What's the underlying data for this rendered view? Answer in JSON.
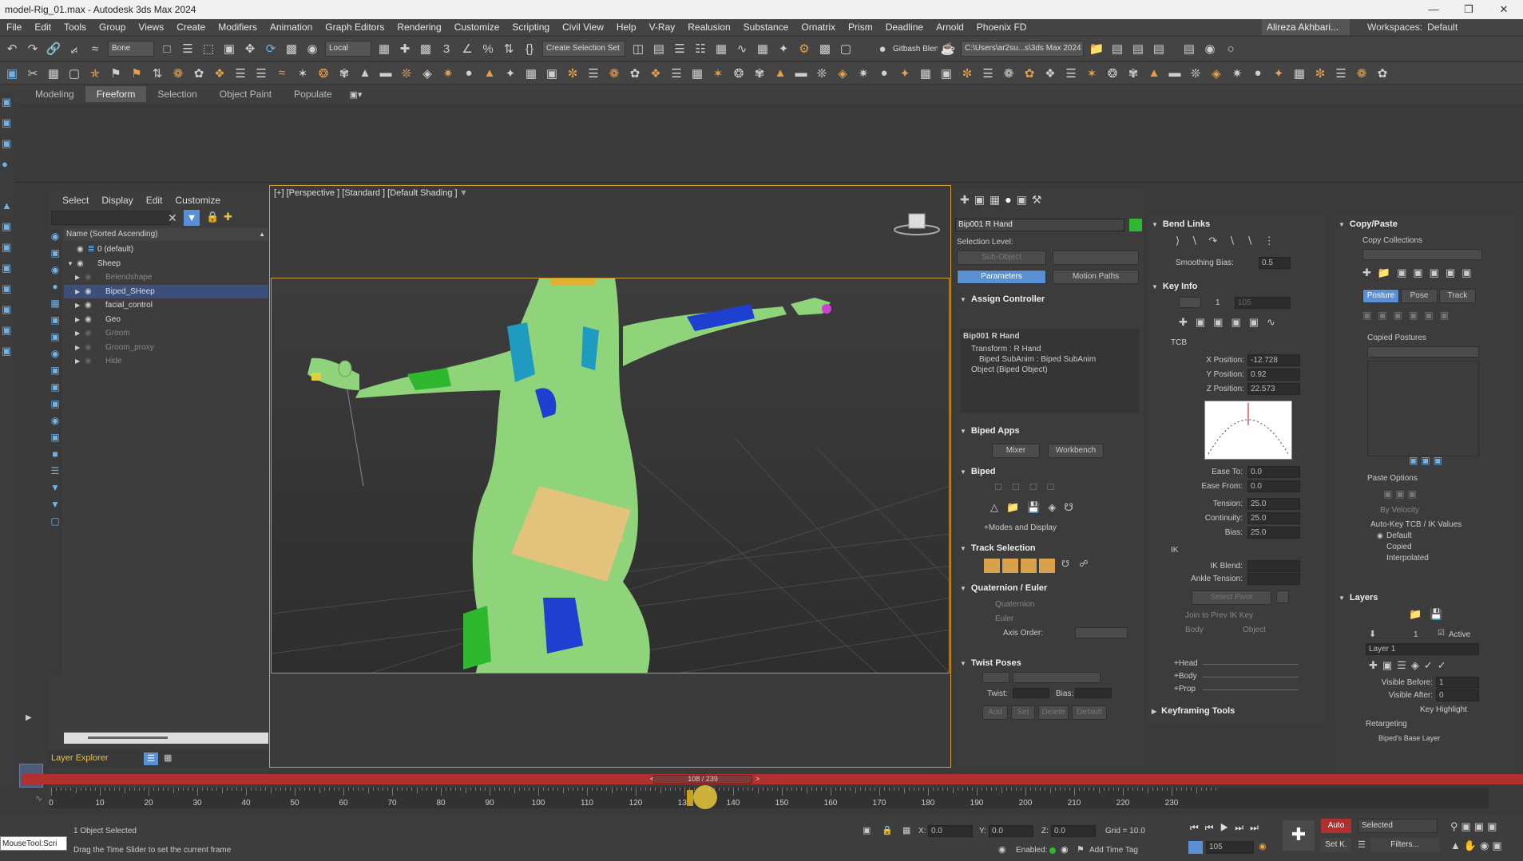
{
  "window": {
    "title": "model-Rig_01.max - Autodesk 3ds Max 2024"
  },
  "menu": {
    "items": [
      "File",
      "Edit",
      "Tools",
      "Group",
      "Views",
      "Create",
      "Modifiers",
      "Animation",
      "Graph Editors",
      "Rendering",
      "Customize",
      "Scripting",
      "Civil View",
      "Help",
      "V-Ray",
      "Realusion",
      "Substance",
      "Ornatrix",
      "Prism",
      "Deadline",
      "Arnold",
      "Phoenix FD"
    ],
    "user": "Alireza Akhbari...",
    "workspace_label": "Workspaces:",
    "workspace_value": "Default"
  },
  "toolbar": {
    "filter_value": "Bone",
    "coord_value": "Local",
    "selection_set": "Create Selection Set",
    "gitbash": "Gitbash Blender",
    "path": "C:\\Users\\ar2su...s\\3ds Max 2024"
  },
  "ribbon": {
    "tabs": [
      "Modeling",
      "Freeform",
      "Selection",
      "Object Paint",
      "Populate"
    ],
    "active": "Freeform"
  },
  "scene_explorer": {
    "menu": [
      "Select",
      "Display",
      "Edit",
      "Customize"
    ],
    "column": "Name (Sorted Ascending)",
    "rows": [
      {
        "label": "0 (default)",
        "depth": 0,
        "state": "normal"
      },
      {
        "label": "Sheep",
        "depth": 0,
        "state": "normal"
      },
      {
        "label": "Belendshape",
        "depth": 1,
        "state": "dim"
      },
      {
        "label": "Biped_SHeep",
        "depth": 1,
        "state": "sel"
      },
      {
        "label": "facial_control",
        "depth": 1,
        "state": "normal"
      },
      {
        "label": "Geo",
        "depth": 1,
        "state": "normal"
      },
      {
        "label": "Groom",
        "depth": 1,
        "state": "dim"
      },
      {
        "label": "Groom_proxy",
        "depth": 1,
        "state": "dim"
      },
      {
        "label": "Hide",
        "depth": 1,
        "state": "dim"
      }
    ],
    "footer": "Layer Explorer"
  },
  "viewport": {
    "label": "[+] [Perspective ] [Standard ] [Default Shading ]"
  },
  "command_panel": {
    "object_name": "Bip001 R Hand",
    "selection_level": "Selection Level:",
    "sub_object": "Sub-Object",
    "parameters": "Parameters",
    "motion_paths": "Motion Paths",
    "assign_controller": "Assign Controller",
    "controller_tree": [
      "Bip001 R Hand",
      "Transform : R Hand",
      "Biped SubAnim : Biped SubAnim",
      "Object (Biped Object)"
    ],
    "biped_apps": "Biped Apps",
    "mixer": "Mixer",
    "workbench": "Workbench",
    "biped": "Biped",
    "modes_display": "+Modes and Display",
    "track_selection": "Track Selection",
    "quat_euler": "Quaternion / Euler",
    "quaternion": "Quaternion",
    "euler": "Euler",
    "axis_order": "Axis Order:",
    "twist_poses": "Twist Poses",
    "twist": "Twist:",
    "bias": "Bias:",
    "add": "Add",
    "set": "Set",
    "delete": "Delete",
    "default": "Default"
  },
  "motion_panel": {
    "bend_links": "Bend Links",
    "smoothing_bias": "Smoothing Bias:",
    "smoothing_value": "0.5",
    "key_info": "Key Info",
    "key_num": "1",
    "key_num2": "105",
    "tcb": "TCB",
    "x_label": "X Position:",
    "x_value": "-12.728",
    "y_label": "Y Position:",
    "y_value": "0.92",
    "z_label": "Z Position:",
    "z_value": "22.573",
    "ease_to": "Ease To:",
    "ease_to_v": "0.0",
    "ease_from": "Ease From:",
    "ease_from_v": "0.0",
    "tension": "Tension:",
    "tension_v": "25.0",
    "continuity": "Continuity:",
    "continuity_v": "25.0",
    "bias": "Bias:",
    "bias_v": "25.0",
    "ik": "IK",
    "ik_blend": "IK Blend:",
    "ankle": "Ankle Tension:",
    "select_pivot": "Select Pivot",
    "join_prev": "Join to Prev IK Key",
    "body": "Body",
    "object": "Object",
    "head": "+Head",
    "bodyp": "+Body",
    "prop": "+Prop",
    "keyframing": "Keyframing Tools"
  },
  "copy_panel": {
    "title": "Copy/Paste",
    "copy_collections": "Copy Collections",
    "tabs": [
      "Posture",
      "Pose",
      "Track"
    ],
    "copied_postures": "Copied Postures",
    "paste_options": "Paste Options",
    "by_velocity": "By Velocity",
    "autokey": "Auto-Key TCB / IK Values",
    "radios": [
      "Default",
      "Copied",
      "Interpolated"
    ],
    "layers": "Layers",
    "layer_num": "1",
    "active": "Active",
    "layer_name": "Layer 1",
    "visible_before": "Visible Before:",
    "vb_value": "1",
    "visible_after": "Visible After:",
    "va_value": "0",
    "key_highlight": "Key Highlight",
    "retargeting": "Retargeting",
    "bipeds_base": "Biped's Base Layer"
  },
  "timeline": {
    "frame": "108 / 239",
    "ticks": [
      0,
      10,
      20,
      30,
      40,
      50,
      60,
      70,
      80,
      90,
      100,
      110,
      120,
      130,
      140,
      150,
      160,
      170,
      180,
      190,
      200,
      210,
      220,
      230
    ]
  },
  "status": {
    "script": "MouseTool:Scri",
    "selected": "1 Object Selected",
    "hint": "Drag the Time Slider to set the current frame",
    "x_label": "X:",
    "x": "0.0",
    "y_label": "Y:",
    "y": "0.0",
    "z_label": "Z:",
    "z": "0.0",
    "grid": "Grid = 10.0",
    "enabled": "Enabled:",
    "add_time_tag": "Add Time Tag",
    "auto": "Auto",
    "selected_dd": "Selected",
    "setk": "Set K.",
    "filters": "Filters...",
    "frame": "105"
  },
  "colors": {
    "accent": "#5b8fd4",
    "timebar": "#b03030",
    "viewport_border": "#d4a22d",
    "sheep": "#8fd47a"
  }
}
